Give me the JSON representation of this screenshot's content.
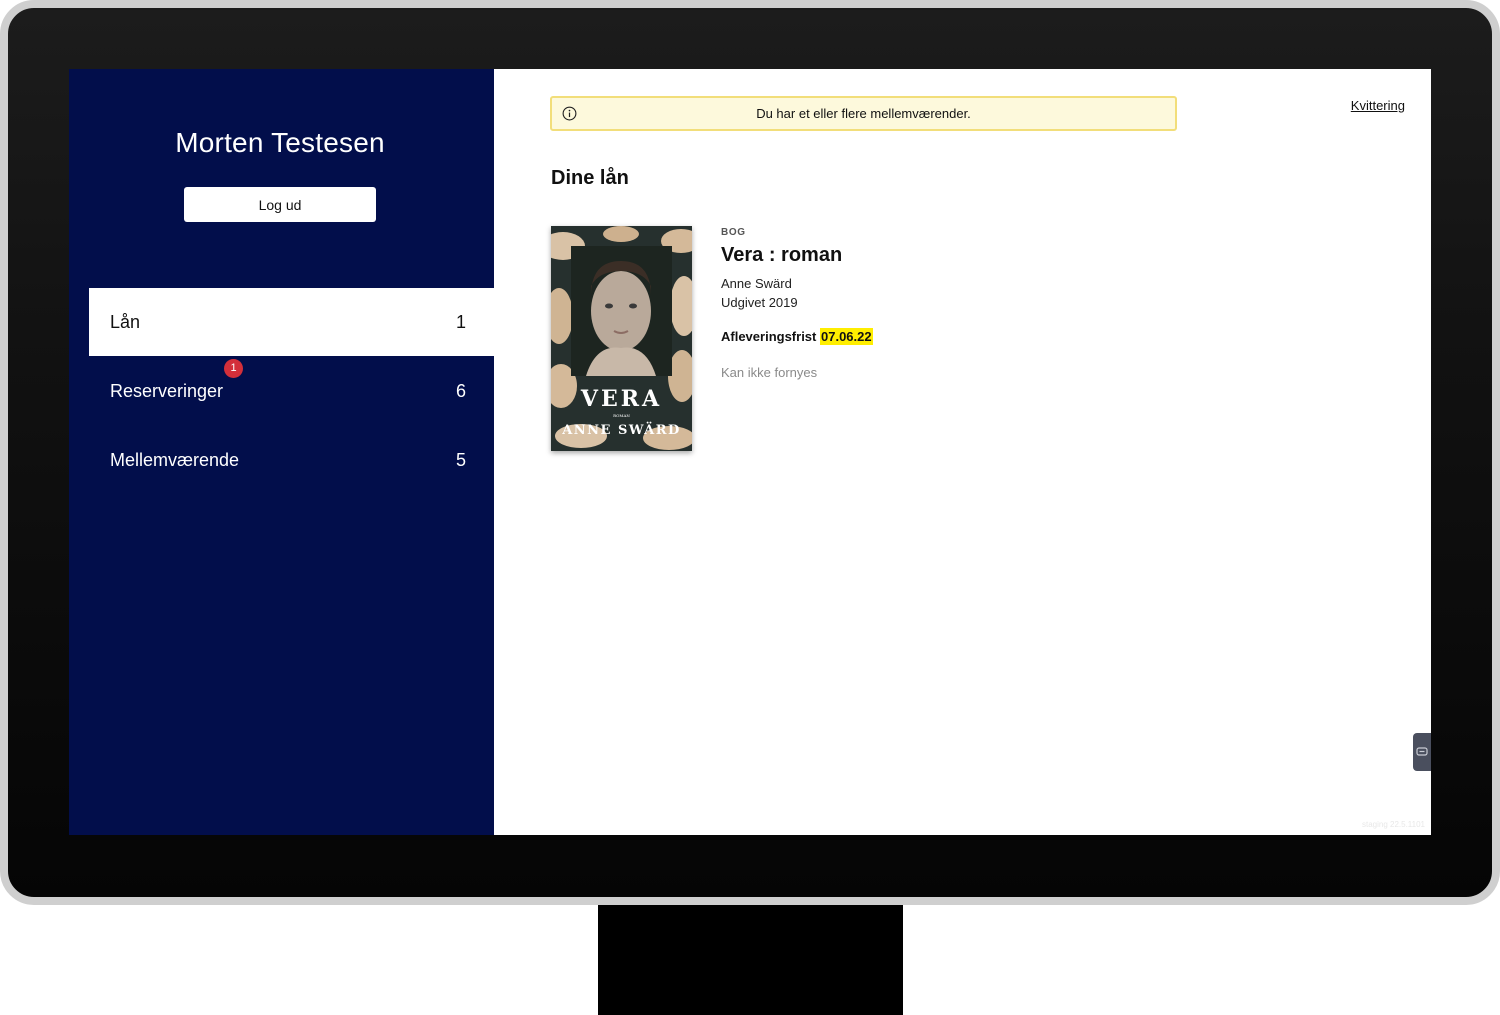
{
  "user": {
    "name": "Morten Testesen",
    "logout_label": "Log ud"
  },
  "nav": {
    "items": [
      {
        "label": "Lån",
        "count": "1",
        "active": true
      },
      {
        "label": "Reserveringer",
        "count": "6",
        "badge": "1"
      },
      {
        "label": "Mellemværende",
        "count": "5"
      }
    ]
  },
  "alert": {
    "message": "Du har et eller flere mellemværender.",
    "icon": "info-icon"
  },
  "header": {
    "receipt_link": "Kvittering"
  },
  "loans": {
    "title": "Dine lån",
    "items": [
      {
        "type": "BOG",
        "title": "Vera : roman",
        "author": "Anne Swärd",
        "published": "Udgivet 2019",
        "due_label": "Afleveringsfrist",
        "due_date": "07.06.22",
        "renew_status": "Kan ikke fornyes",
        "cover": {
          "title": "VERA",
          "subtitle": "ROMAN",
          "author": "ANNE SWÄRD"
        }
      }
    ]
  },
  "footer": {
    "version": "staging 22.5.1101"
  },
  "colors": {
    "sidebar_bg": "#020e4b",
    "alert_bg": "#fdf9dc",
    "alert_border": "#f2de7a",
    "due_highlight": "#ffee00",
    "badge": "#d32f3a"
  }
}
